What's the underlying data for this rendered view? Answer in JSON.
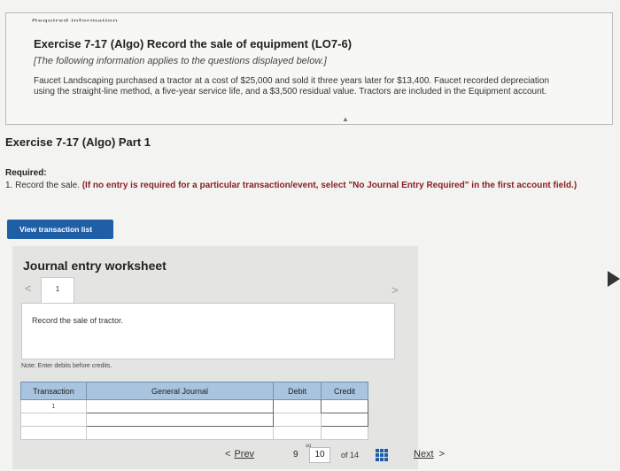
{
  "info": {
    "cut_title": "Required information",
    "title": "Exercise 7-17 (Algo) Record the sale of equipment (LO7-6)",
    "subtitle": "[The following information applies to the questions displayed below.]",
    "body": "Faucet Landscaping purchased a tractor at a cost of $25,000 and sold it three years later for $13,400. Faucet recorded depreciation using the straight-line method, a five-year service life, and a $3,500 residual value. Tractors are included in the Equipment account."
  },
  "part": {
    "title": "Exercise 7-17 (Algo) Part 1"
  },
  "required": {
    "label": "Required:",
    "text_plain": "1. Record the sale. ",
    "text_bold": "(If no entry is required for a particular transaction/event, select \"No Journal Entry Required\" in the first account field.)"
  },
  "view_button": {
    "label": "View transaction list"
  },
  "worksheet": {
    "title": "Journal entry worksheet",
    "page": "1",
    "prev_glyph": "<",
    "next_glyph": ">",
    "record_text": "Record the sale of tractor.",
    "note": "Note: Enter debits before credits.",
    "columns": [
      "Transaction",
      "General Journal",
      "Debit",
      "Credit"
    ],
    "rows": [
      {
        "transaction": "1"
      },
      {
        "transaction": ""
      },
      {
        "transaction": ""
      }
    ]
  },
  "nav": {
    "prev_glyph": "<",
    "prev_label": "Prev",
    "current_page": "9",
    "next_page": "10",
    "of_label": "of 14",
    "next_label": "Next",
    "next_glyph": ">",
    "link_icon": "link-icon",
    "grid_icon": "grid-icon"
  },
  "colors": {
    "accent": "#1f5fa8",
    "table_header": "#a8c4df"
  }
}
